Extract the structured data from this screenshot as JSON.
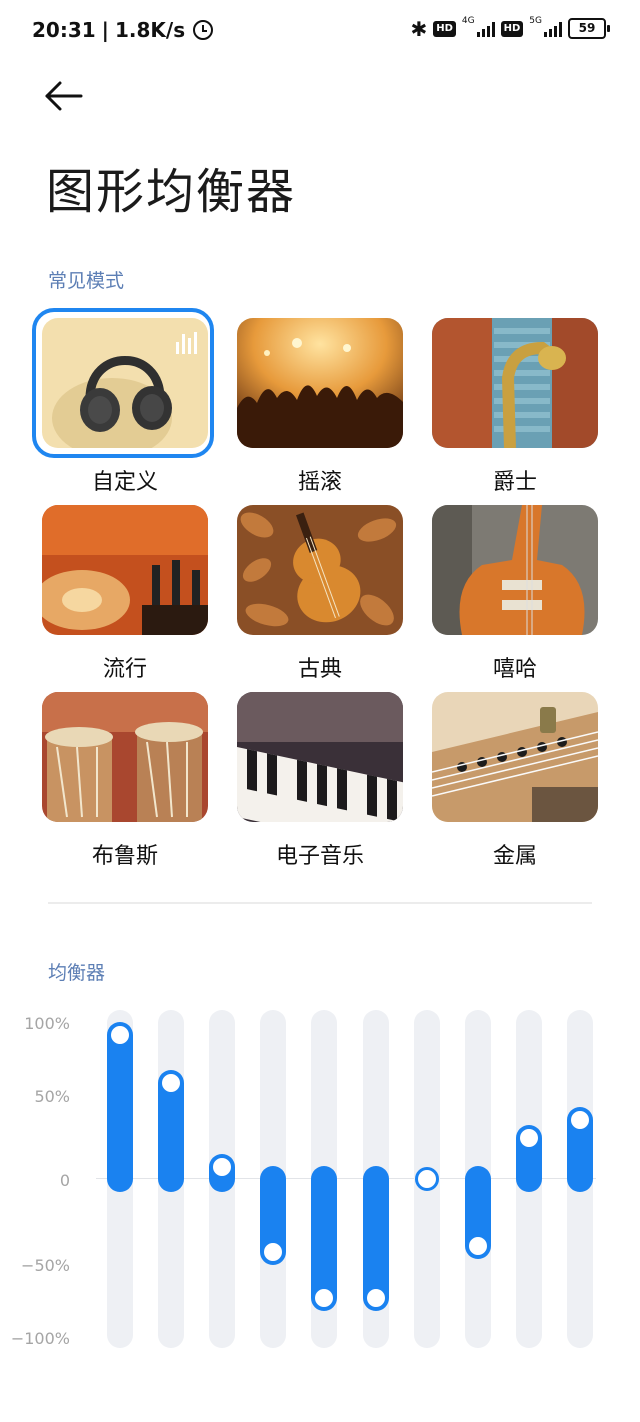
{
  "status_bar": {
    "time": "20:31",
    "speed": "1.8K/s",
    "net_label_1": "4G",
    "net_label_2": "5G",
    "hd_1": "HD",
    "hd_2": "HD",
    "battery": "59"
  },
  "header": {
    "title": "图形均衡器"
  },
  "presets_section": {
    "label": "常见模式",
    "items": [
      {
        "label": "自定义",
        "icon": "headphones",
        "selected": true
      },
      {
        "label": "摇滚",
        "icon": "concert-crowd",
        "selected": false
      },
      {
        "label": "爵士",
        "icon": "saxophone",
        "selected": false
      },
      {
        "label": "流行",
        "icon": "dj-turntable",
        "selected": false
      },
      {
        "label": "古典",
        "icon": "violin",
        "selected": false
      },
      {
        "label": "嘻哈",
        "icon": "electric-guitar",
        "selected": false
      },
      {
        "label": "布鲁斯",
        "icon": "drums",
        "selected": false
      },
      {
        "label": "电子音乐",
        "icon": "keyboard",
        "selected": false
      },
      {
        "label": "金属",
        "icon": "guitar-strings",
        "selected": false
      }
    ]
  },
  "equalizer": {
    "label": "均衡器",
    "axis_labels": [
      "100%",
      "50%",
      "0",
      "−50%",
      "−100%"
    ],
    "band_levels_percent": [
      95,
      63,
      8,
      -48,
      -78,
      -78,
      0,
      -44,
      27,
      39
    ],
    "accent_color": "#1a82f0"
  }
}
